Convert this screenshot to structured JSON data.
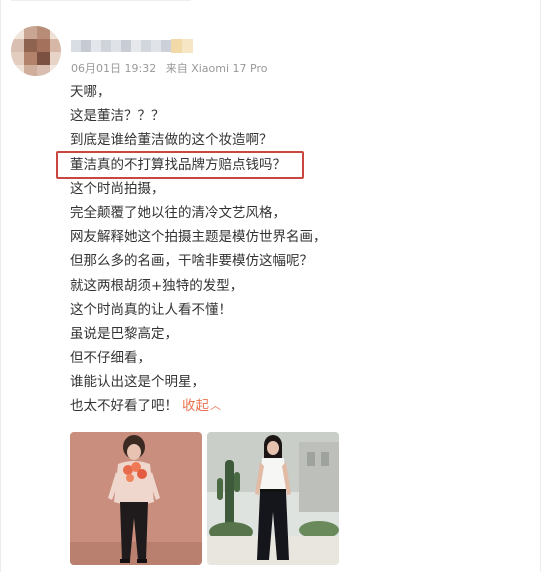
{
  "post": {
    "meta": {
      "date": "06月01日 19:32",
      "source": "来自 Xiaomi 17 Pro"
    },
    "lines": [
      "天哪，",
      "这是董洁？？？",
      "到底是谁给董洁做的这个妆造啊？",
      "董洁真的不打算找品牌方赔点钱吗？",
      "这个时尚拍摄，",
      "完全颠覆了她以往的清冷文艺风格，",
      "网友解释她这个拍摄主题是模仿世界名画，",
      "但那么多的名画，干啥非要模仿这幅呢？",
      "就这两根胡须+独特的发型，",
      "这个时尚真的让人看不懂！",
      "虽说是巴黎高定，",
      "但不仔细看，",
      "谁能认出这是个明星，",
      "也太不好看了吧！"
    ],
    "collapse_label": "收起",
    "highlighted_line_index": 3
  },
  "colors": {
    "text": "#333333",
    "meta": "#999999",
    "link": "#eb7350",
    "highlight_border": "#c9473f"
  },
  "icons": {
    "collapse": "chevron-up-icon"
  }
}
